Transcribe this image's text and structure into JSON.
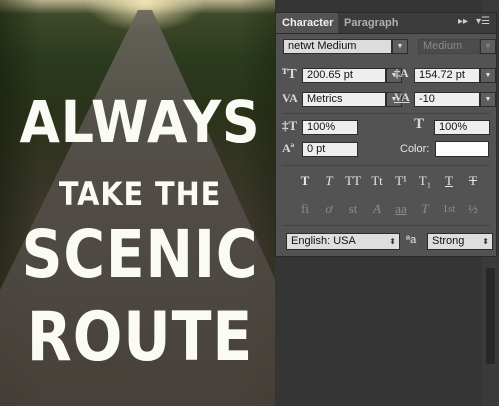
{
  "poster": {
    "line1": "ALWAYS",
    "line2": "TAKE THE",
    "line3": "SCENIC",
    "line4": "ROUTE"
  },
  "panel": {
    "tabs": [
      "Character",
      "Paragraph"
    ],
    "collapse_icon": "double-chevron-right-icon",
    "menu_icon": "panel-menu-icon",
    "font_family": "netwt Medium",
    "font_style": "Medium",
    "font_size": "200.65 pt",
    "leading": "154.72 pt",
    "kerning": "Metrics",
    "tracking": "-10",
    "vertical_scale": "100%",
    "horizontal_scale": "100%",
    "baseline_shift": "0 pt",
    "color_label": "Color:",
    "color_value": "#ffffff",
    "style_buttons": [
      "T",
      "T",
      "TT",
      "Tt",
      "T¹",
      "T₁",
      "T",
      "T"
    ],
    "opentype_buttons": [
      "fi",
      "ơ",
      "st",
      "A",
      "aa",
      "T",
      "1st",
      "½"
    ],
    "language": "English: USA",
    "aa_label": "ªa",
    "antialias": "Strong"
  }
}
